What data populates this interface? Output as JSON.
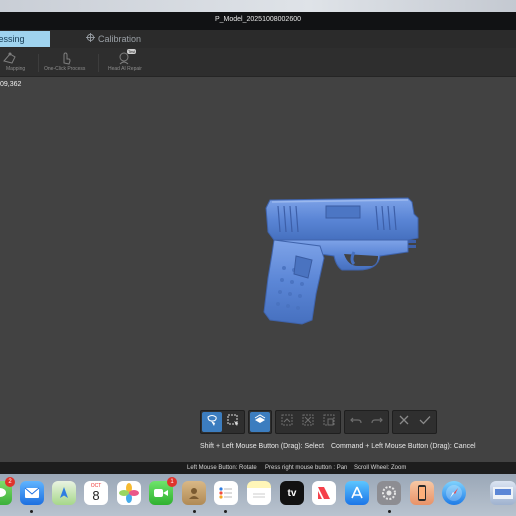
{
  "window": {
    "title": "P_Model_20251008002600"
  },
  "tabs": {
    "active": "Processing",
    "active_visible": "cessing",
    "calibration": "Calibration"
  },
  "toolstrip": {
    "mapping_label": "Mapping",
    "one_click_label": "One-Click Process",
    "head_ai_label": "Head AI Repair",
    "head_ai_badge": "Test"
  },
  "viewport": {
    "triangle_count": "09,362"
  },
  "hints": {
    "select": "Shift + Left Mouse Button (Drag): Select",
    "cancel": "Command + Left Mouse Button (Drag): Cancel"
  },
  "status": {
    "rotate": "Left Mouse Button: Rotate",
    "pan": "Press right mouse button : Pan",
    "zoom": "Scroll Wheel: Zoom"
  },
  "dock": {
    "items": [
      {
        "name": "messages-partial",
        "badge": "2"
      },
      {
        "name": "mail"
      },
      {
        "name": "maps"
      },
      {
        "name": "calendar",
        "month": "OCT",
        "day": "8"
      },
      {
        "name": "photos"
      },
      {
        "name": "facetime",
        "badge": "1"
      },
      {
        "name": "contacts"
      },
      {
        "name": "reminders"
      },
      {
        "name": "notes"
      },
      {
        "name": "apple-tv",
        "label": "tv"
      },
      {
        "name": "news"
      },
      {
        "name": "app-store"
      },
      {
        "name": "system-settings"
      },
      {
        "name": "iphone-mirroring"
      },
      {
        "name": "safari"
      },
      {
        "name": "preview-window"
      }
    ]
  },
  "colors": {
    "accent": "#3c7dbf",
    "active_tab": "#9fd3ee",
    "model": "#5b86d6"
  }
}
